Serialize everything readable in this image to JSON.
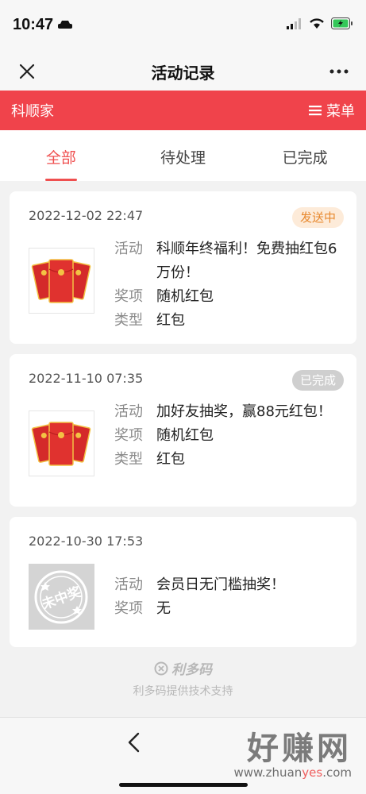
{
  "status": {
    "time": "10:47"
  },
  "nav": {
    "title": "活动记录"
  },
  "brand": {
    "name": "科顺家",
    "menu_label": "菜单"
  },
  "tabs": [
    {
      "label": "全部",
      "active": true
    },
    {
      "label": "待处理",
      "active": false
    },
    {
      "label": "已完成",
      "active": false
    }
  ],
  "records": [
    {
      "date": "2022-12-02 22:47",
      "status": "发送中",
      "activity_label": "活动",
      "activity": "科顺年终福利！免费抽红包6万份！",
      "prize_label": "奖项",
      "prize": "随机红包",
      "type_label": "类型",
      "type": "红包"
    },
    {
      "date": "2022-11-10 07:35",
      "status": "已完成",
      "activity_label": "活动",
      "activity": "加好友抽奖，赢88元红包！",
      "prize_label": "奖项",
      "prize": "随机红包",
      "type_label": "类型",
      "type": "红包"
    },
    {
      "date": "2022-10-30 17:53",
      "activity_label": "活动",
      "activity": "会员日无门槛抽奖！",
      "prize_label": "奖项",
      "prize": "无",
      "stamp_text": "未中奖"
    }
  ],
  "footer": {
    "logo": "利多码",
    "support": "利多码提供技术支持"
  },
  "watermark": {
    "main": "好赚网",
    "url_pre": "www.zhuan",
    "url_accent": "yes",
    "url_post": ".com"
  },
  "colors": {
    "brand": "#f0434b",
    "active_tab": "#ef4f4f",
    "sending": "#e8892f",
    "done": "#cfcfcf"
  }
}
